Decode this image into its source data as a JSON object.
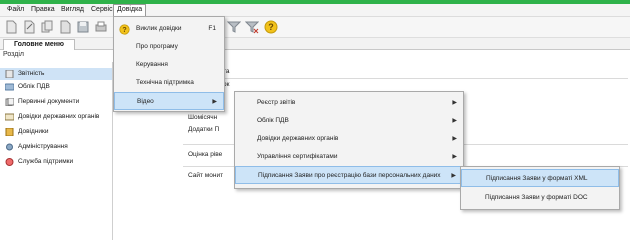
{
  "menubar": {
    "items": [
      "Файл",
      "Правка",
      "Вигляд",
      "Сервіс",
      "Довідка"
    ]
  },
  "tabs": {
    "main": "Головне меню"
  },
  "section_label": "Розділ",
  "sidebar": {
    "items": [
      {
        "label": "Звітність"
      },
      {
        "label": "Облік ПДВ"
      },
      {
        "label": "Первинні документи"
      },
      {
        "label": "Довідки державних органів"
      },
      {
        "label": "Довідники"
      },
      {
        "label": "Адміністрування"
      },
      {
        "label": "Служба підтримки"
      }
    ]
  },
  "main": {
    "fragment1": "та",
    "fragment2": "ок",
    "row1": "Шомісячн",
    "row2": "Додатки П",
    "row3": "Оцінка ріве",
    "row4": "Сайт монит"
  },
  "help_menu": {
    "items": [
      {
        "label": "Виклик довідки",
        "shortcut": "F1"
      },
      {
        "label": "Про програму"
      },
      {
        "label": "Керування"
      },
      {
        "label": "Технічна підтримка"
      },
      {
        "label": "Відео"
      }
    ]
  },
  "video_menu": {
    "items": [
      {
        "label": "Реєстр звітів"
      },
      {
        "label": "Облік ПДВ"
      },
      {
        "label": "Довідки державних органів"
      },
      {
        "label": "Управління сертифікатами"
      },
      {
        "label": "Підписання Заяви про реєстрацію бази персональних даних"
      }
    ]
  },
  "signing_menu": {
    "items": [
      {
        "label": "Підписання Заяви у форматі XML"
      },
      {
        "label": "Підписання Заяви у форматі DOC"
      }
    ]
  },
  "colors": {
    "accent_green": "#2fb24a",
    "selection_blue": "#cde4f8",
    "help_icon": "#f2c21b"
  }
}
